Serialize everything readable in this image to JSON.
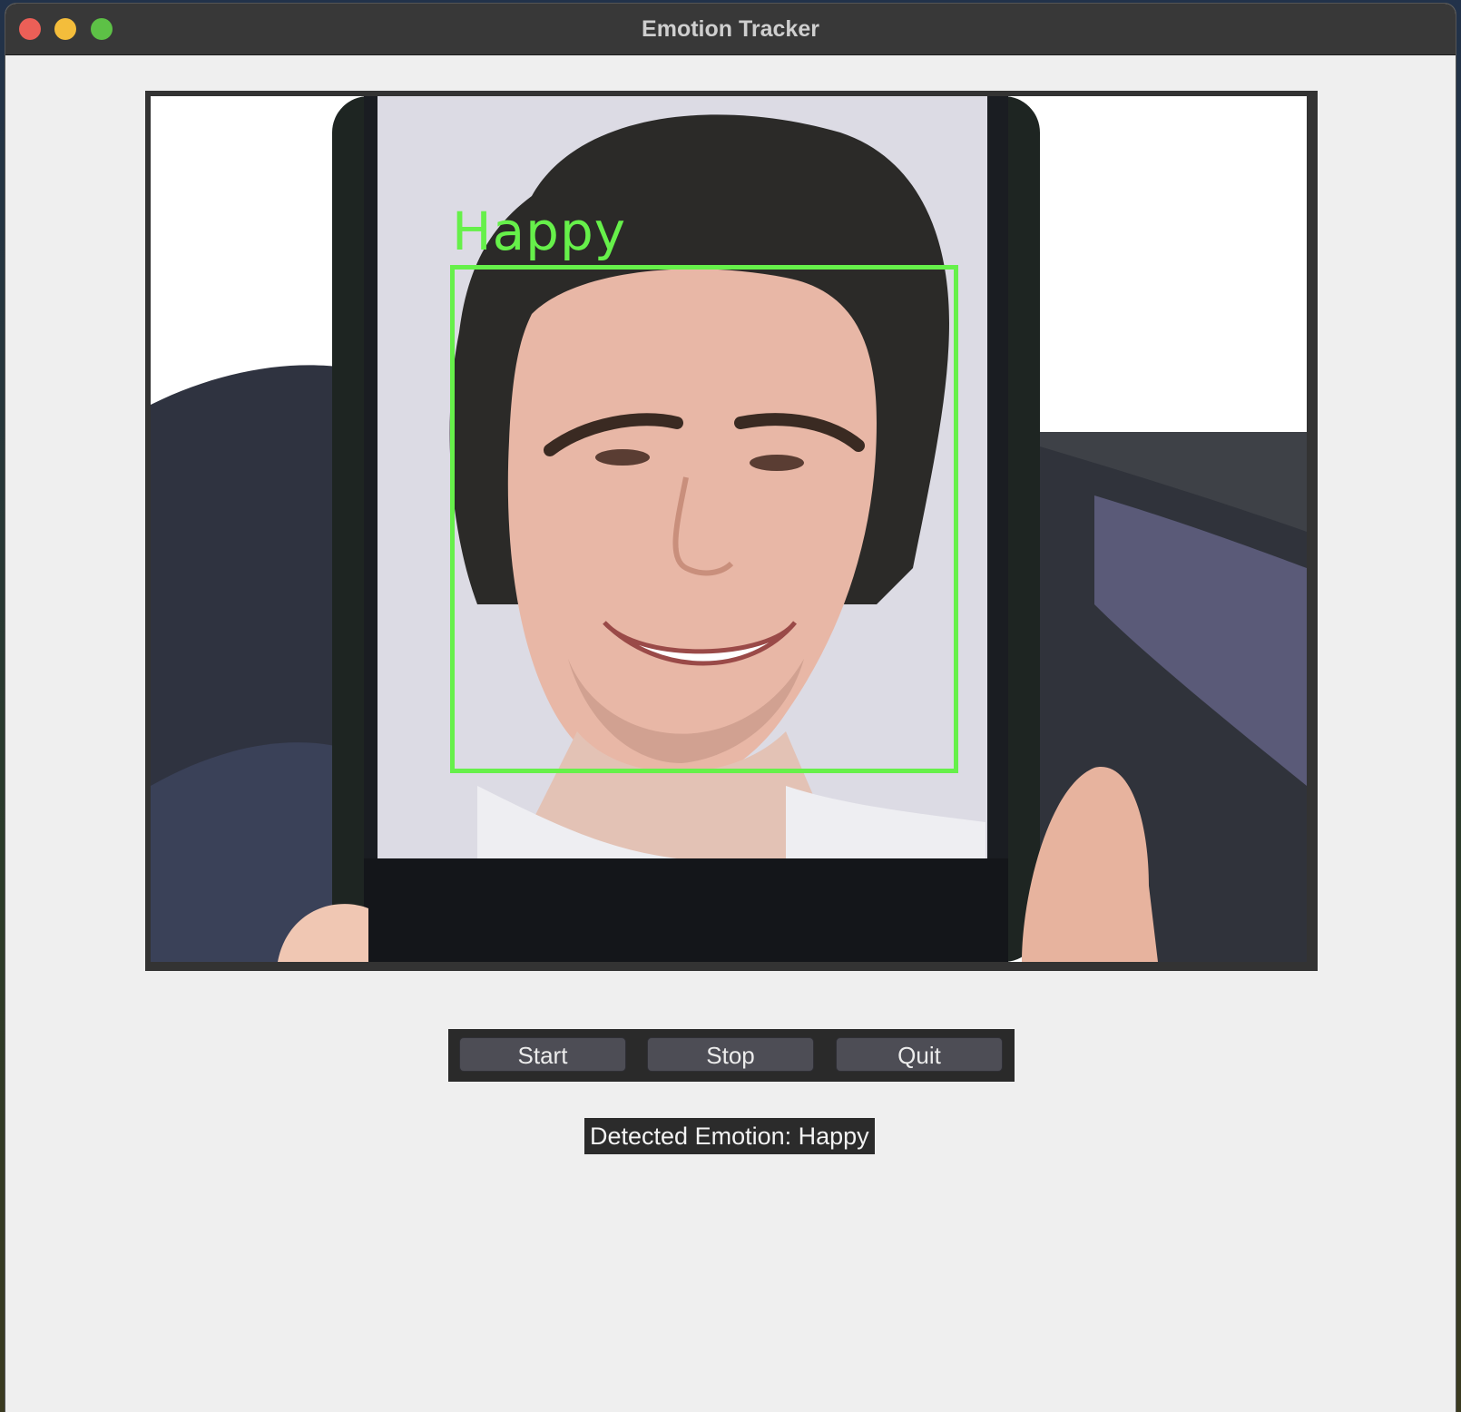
{
  "window": {
    "title": "Emotion Tracker"
  },
  "video": {
    "overlay_label": "Happy",
    "overlay_color": "#66f04a"
  },
  "controls": {
    "start_label": "Start",
    "stop_label": "Stop",
    "quit_label": "Quit"
  },
  "status": {
    "text": "Detected Emotion: Happy"
  },
  "colors": {
    "titlebar": "#383838",
    "window_bg": "#efefef",
    "button_bg": "#4d4d55",
    "status_bg": "#2b2b2b"
  }
}
